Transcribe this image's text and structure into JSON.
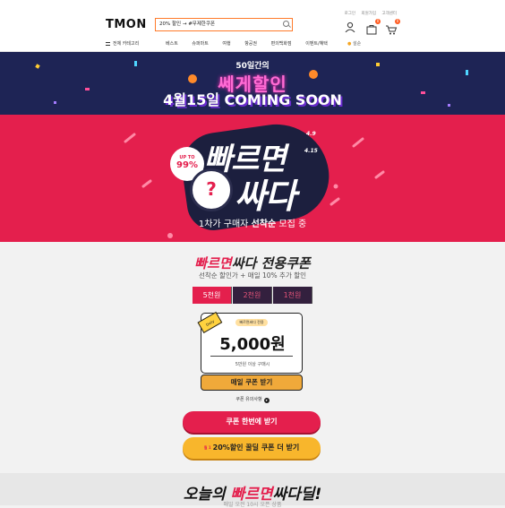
{
  "header": {
    "logo": "TMON",
    "search_value": "20% 할인 → #무제한쿠폰",
    "top_links": [
      "로그인",
      "회원가입",
      "고객센터"
    ],
    "cart_count": "0",
    "bag_count": "0"
  },
  "nav": {
    "category_label": "전체 카테고리",
    "items": [
      "베스트",
      "슈퍼마트",
      "여행",
      "항공권",
      "편의백화점",
      "이벤트/혜택"
    ],
    "right_label": "설순"
  },
  "banner_top": {
    "line1": "50일간의",
    "line2": "쎄게할인",
    "line3": "4월15일 COMING SOON"
  },
  "banner_main": {
    "upto_label": "UP TO",
    "upto_value": "99%",
    "headline1": "빠르면",
    "headline2": "싸다",
    "date_start": "4.9",
    "date_end": "4.15",
    "question_mark": "?",
    "subtext_pre": "1차가 구매자 ",
    "subtext_bold": "선착순",
    "subtext_post": " 모집 중"
  },
  "coupon": {
    "title_red": "빠르면",
    "title_rest": "싸다 전용쿠폰",
    "subtitle": "선착순 할인가 + 매일 10% 추가 할인",
    "tabs": [
      "5천원",
      "2천원",
      "1천원"
    ],
    "active_tab": 0,
    "card_corner": "Daily",
    "card_pill": "빠르면싸다 전용",
    "card_amount": "5,000원",
    "card_condition": "5만원 이상 구매시",
    "daily_button": "매일 쿠폰 받기",
    "notice": "쿠폰 유의사항"
  },
  "actions": {
    "btn_all": "쿠폰 한번에 받기",
    "btn_extra_pre": "월 1",
    "btn_extra": "20%할인 꿀딜 쿠폰 더 받기"
  },
  "bottom": {
    "title_pre": "오늘의 ",
    "title_red": "빠르면",
    "title_post": "싸다딜!",
    "subtitle": "매일 오전 10시 오픈 상품"
  },
  "colors": {
    "brand_red": "#e41f4d",
    "navy": "#1e2455",
    "orange": "#ff5a1f",
    "yellow": "#f8b62c"
  }
}
